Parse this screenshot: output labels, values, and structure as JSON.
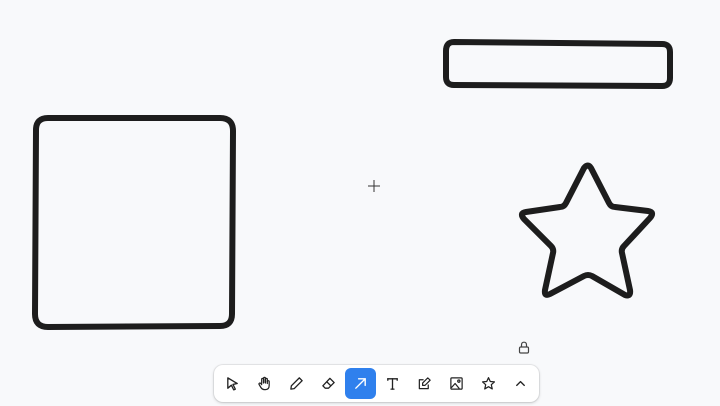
{
  "canvas": {
    "background": "#f8f9fb",
    "stroke_color": "#1d1d1d"
  },
  "shapes": [
    {
      "kind": "rectangle",
      "name": "shape-rectangle-large"
    },
    {
      "kind": "rectangle",
      "name": "shape-rectangle-wide"
    },
    {
      "kind": "star",
      "name": "shape-star"
    }
  ],
  "toolbar": {
    "accent": "#2f80ed",
    "active_tool": "arrow",
    "tools": [
      {
        "id": "select",
        "icon": "cursor-pointer-icon"
      },
      {
        "id": "hand",
        "icon": "hand-icon"
      },
      {
        "id": "draw",
        "icon": "pencil-icon"
      },
      {
        "id": "eraser",
        "icon": "eraser-icon"
      },
      {
        "id": "arrow",
        "icon": "arrow-diagonal-icon"
      },
      {
        "id": "text",
        "icon": "text-icon"
      },
      {
        "id": "note",
        "icon": "note-edit-icon"
      },
      {
        "id": "media",
        "icon": "image-icon"
      },
      {
        "id": "shape",
        "icon": "star-icon"
      },
      {
        "id": "more",
        "icon": "chevron-up-icon"
      }
    ]
  },
  "overlays": {
    "cursor": "crosshair-cursor-icon",
    "lock": "lock-icon"
  }
}
